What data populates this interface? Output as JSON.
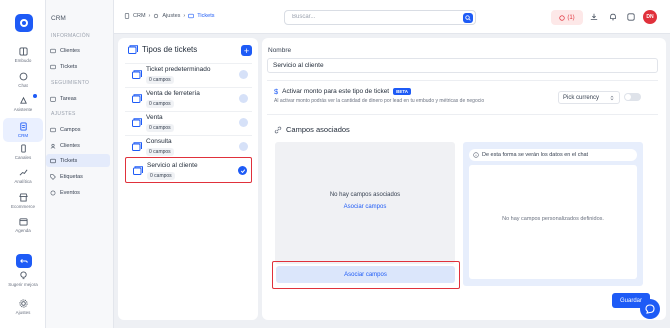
{
  "rail": {
    "items": [
      {
        "label": "Embudo",
        "icon": "funnel-icon"
      },
      {
        "label": "Chat",
        "icon": "chat-icon"
      },
      {
        "label": "Asistente",
        "icon": "assistant-icon"
      },
      {
        "label": "CRM",
        "icon": "crm-icon"
      },
      {
        "label": "Canales",
        "icon": "phone-icon"
      },
      {
        "label": "Analítica",
        "icon": "analytics-icon"
      },
      {
        "label": "Ecommerce",
        "icon": "store-icon"
      },
      {
        "label": "Agenda",
        "icon": "calendar-icon"
      },
      {
        "label": "Sugerir mejora",
        "icon": "lightbulb-icon"
      },
      {
        "label": "Ajustes",
        "icon": "gear-icon"
      }
    ]
  },
  "subnav": {
    "title": "CRM",
    "section_info": "INFORMACIÓN",
    "section_seg": "SEGUIMIENTO",
    "section_ajustes": "AJUSTES",
    "items": {
      "clientes": "Clientes",
      "tickets": "Tickets",
      "tareas": "Tareas",
      "campos": "Campos",
      "clientes2": "Clientes",
      "tickets2": "Tickets",
      "etiquetas": "Etiquetas",
      "eventos": "Eventos"
    }
  },
  "topbar": {
    "crumb1": "CRM",
    "crumb2": "Ajustes",
    "crumb3": "Tickets",
    "search_placeholder": "Buscar...",
    "notif_count": "(1)",
    "avatar_initials": "DN",
    "accent": "#1e5bf6",
    "alert": "#e0313b"
  },
  "types": {
    "title": "Tipos de tickets",
    "add": "+",
    "cards": [
      {
        "name": "Ticket predeterminado",
        "count": "0 campos"
      },
      {
        "name": "Venta de ferretería",
        "count": "0 campos"
      },
      {
        "name": "Venta",
        "count": "0 campos"
      },
      {
        "name": "Consulta",
        "count": "0 campos"
      },
      {
        "name": "Servicio al cliente",
        "count": "0 campos"
      }
    ]
  },
  "detail": {
    "name_label": "Nombre",
    "name_value": "Servicio al cliente",
    "monto_title": "Activar monto para este tipo de ticket",
    "beta": "BETA",
    "monto_desc": "Al activar monto podrás ver la cantidad de dinero por lead en tu embudo y métricas de negocio",
    "currency": "Pick currency",
    "campos_title": "Campos asociados",
    "empty_msg": "No hay campos asociados",
    "empty_link": "Asociar campos",
    "assoc_button": "Asociar campos",
    "preview_title": "De esta forma se verán los datos en el chat",
    "preview_empty": "No hay campos personalizados definidos.",
    "save": "Guardar"
  }
}
